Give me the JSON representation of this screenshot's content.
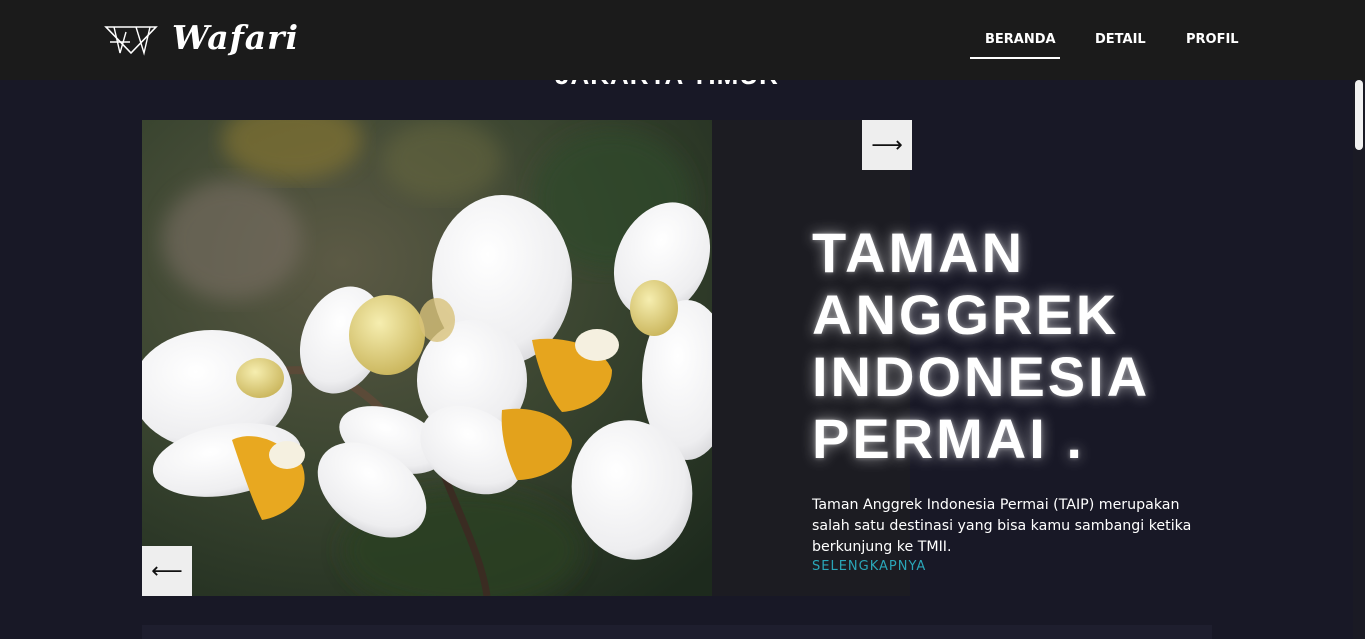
{
  "brand": {
    "name": "Wafari",
    "logo_icon": "triangle-mark-icon"
  },
  "nav": {
    "items": [
      {
        "label": "BERANDA",
        "active": true
      },
      {
        "label": "DETAIL",
        "active": false
      },
      {
        "label": "PROFIL",
        "active": false
      }
    ]
  },
  "section": {
    "title": "JAKARTA TIMUR"
  },
  "slide": {
    "heading": "TAMAN ANGGREK INDONESIA PERMAI .",
    "description": "Taman Anggrek Indonesia Permai (TAIP) merupakan salah satu destinasi yang bisa kamu sambangi ketika berkunjung ke TMII.",
    "read_more": "SELENGKAPNYA",
    "image_alt": "white-orchid-photo",
    "next_icon": "arrow-right-icon",
    "prev_icon": "arrow-left-icon"
  },
  "colors": {
    "background": "#181826",
    "navbar": "#1b1b1b",
    "accent": "#2aa6b8",
    "button": "#eeeeee"
  }
}
